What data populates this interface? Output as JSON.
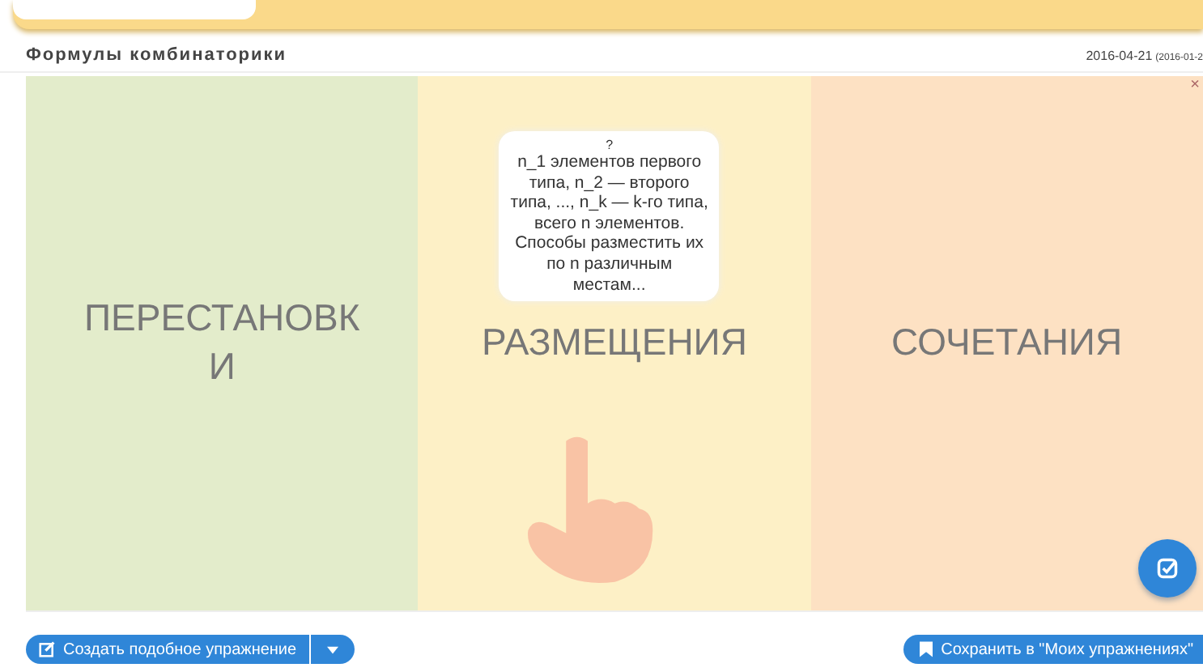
{
  "title": "Формулы комбинаторики",
  "date": "2016-04-21",
  "date_note": "(2016-01-2",
  "close_mark": "×",
  "columns": [
    {
      "label": "ПЕРЕСТАНОВКИ",
      "color": "#e3eccb"
    },
    {
      "label": "РАЗМЕЩЕНИЯ",
      "color": "#fdf0c6"
    },
    {
      "label": "СОЧЕТАНИЯ",
      "color": "#fde1c3"
    }
  ],
  "tooltip": {
    "mark": "?",
    "text": "n_1 элементов первого типа, n_2 — второго типа, ..., n_k — k-го типа, всего n элементов. Способы разместить их по n различным местам..."
  },
  "buttons": [
    {
      "kind": "create",
      "label": "Создать подобное упражнение"
    },
    {
      "kind": "save",
      "label": "Сохранить в \"Моих упражнениях\""
    }
  ]
}
